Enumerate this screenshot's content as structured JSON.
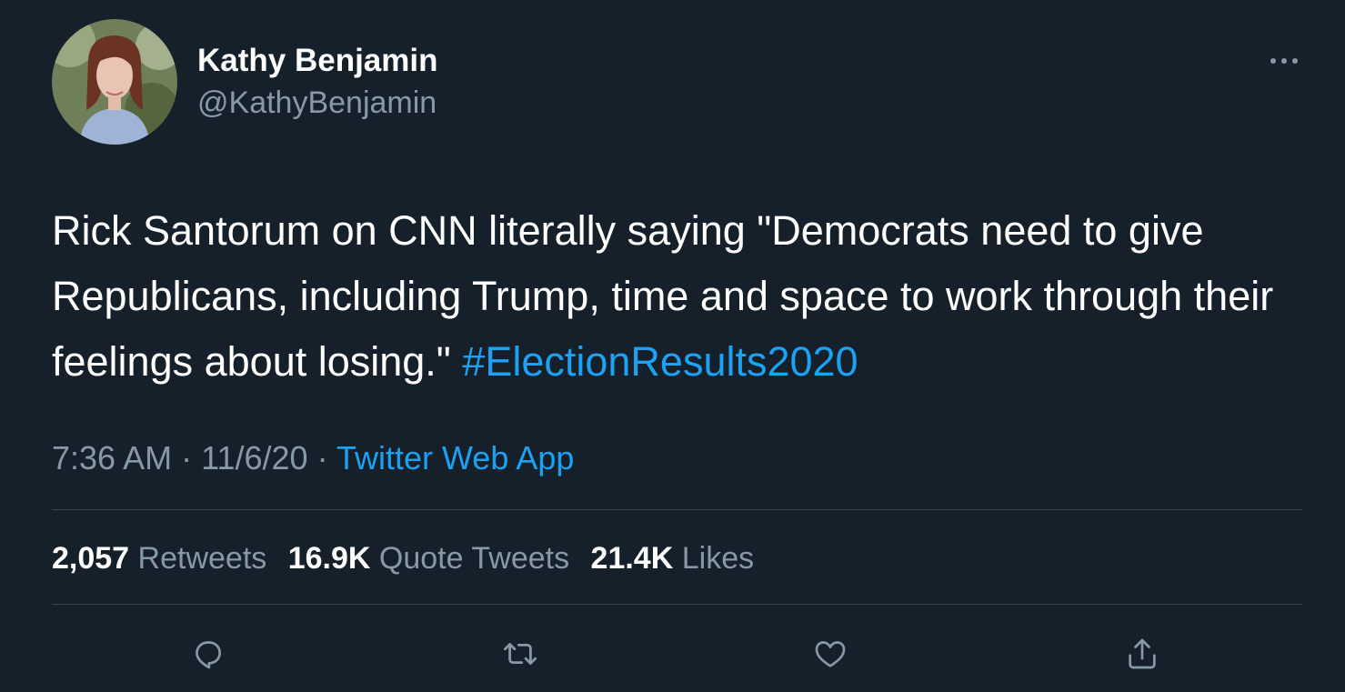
{
  "author": {
    "name": "Kathy Benjamin",
    "handle": "@KathyBenjamin"
  },
  "tweet": {
    "text": "Rick Santorum on CNN literally saying \"Democrats need to give Republicans, including Trump, time and space to work through their feelings about losing.\"",
    "hashtag": "#ElectionResults2020"
  },
  "meta": {
    "time": "7:36 AM",
    "separator1": "·",
    "date": "11/6/20",
    "separator2": "·",
    "source": "Twitter Web App"
  },
  "stats": {
    "retweets_count": "2,057",
    "retweets_label": "Retweets",
    "quote_tweets_count": "16.9K",
    "quote_tweets_label": "Quote Tweets",
    "likes_count": "21.4K",
    "likes_label": "Likes"
  },
  "icons": {
    "more": "more-icon",
    "reply": "reply-icon",
    "retweet": "retweet-icon",
    "like": "heart-icon",
    "share": "share-icon"
  },
  "colors": {
    "background": "#15202b",
    "accent": "#1da1f2",
    "secondary_text": "#8899a6",
    "divider": "#38444d"
  }
}
